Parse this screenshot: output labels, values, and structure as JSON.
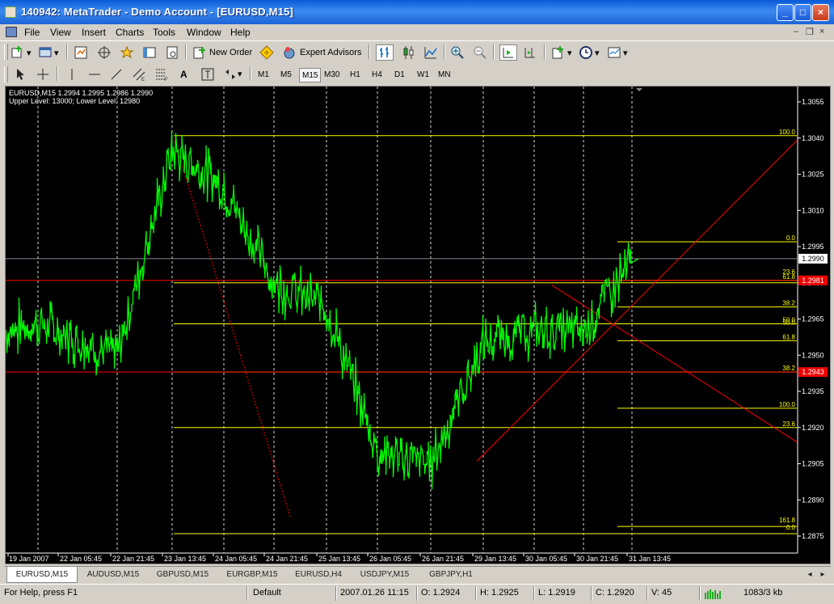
{
  "window": {
    "title": "140942: MetaTrader - Demo Account - [EURUSD,M15]"
  },
  "menu": [
    "File",
    "View",
    "Insert",
    "Charts",
    "Tools",
    "Window",
    "Help"
  ],
  "toolbar": {
    "new_order_label": "New Order",
    "expert_advisors_label": "Expert Advisors"
  },
  "timeframes": [
    "M1",
    "M5",
    "M15",
    "M30",
    "H1",
    "H4",
    "D1",
    "W1",
    "MN"
  ],
  "active_timeframe": "M15",
  "chart": {
    "header_line1": "EURUSD,M15  1.2994 1.2995 1.2986 1.2990",
    "header_line2": "Upper Level: 13000;  Lower Level: 12980",
    "price_labels": [
      "1.3055",
      "1.3040",
      "1.3025",
      "1.3010",
      "1.2995",
      "1.2980",
      "1.2965",
      "1.2950",
      "1.2935",
      "1.2920",
      "1.2905",
      "1.2890",
      "1.2875"
    ],
    "current_price": "1.2990",
    "red_level_upper": "1.2981",
    "red_level_lower": "1.2943",
    "fib_labels": [
      "100.0",
      "0.0",
      "23.6",
      "61.8",
      "38.2",
      "50.0",
      "50.0",
      "61.8",
      "38.2",
      "100.0",
      "23.6",
      "161.8",
      "0.0"
    ],
    "time_labels": [
      "19 Jan 2007",
      "22 Jan 05:45",
      "22 Jan 21:45",
      "23 Jan 13:45",
      "24 Jan 05:45",
      "24 Jan 21:45",
      "25 Jan 13:45",
      "26 Jan 05:45",
      "26 Jan 21:45",
      "29 Jan 13:45",
      "30 Jan 05:45",
      "30 Jan 21:45",
      "31 Jan 13:45"
    ],
    "colors": {
      "background": "#000000",
      "candles": "#00ff00",
      "fibo": "#ffff00",
      "levels": "#ff0000",
      "grid": "#ffffff"
    }
  },
  "chart_data": {
    "type": "line",
    "title": "EURUSD,M15",
    "xlabel": "",
    "ylabel": "",
    "ylim": [
      1.287,
      1.306
    ],
    "x": [
      "19 Jan 2007",
      "22 Jan 05:45",
      "22 Jan 21:45",
      "23 Jan 13:45",
      "24 Jan 05:45",
      "24 Jan 21:45",
      "25 Jan 13:45",
      "26 Jan 05:45",
      "26 Jan 21:45",
      "29 Jan 13:45",
      "30 Jan 05:45",
      "30 Jan 21:45",
      "31 Jan 13:45"
    ],
    "series": [
      {
        "name": "EURUSD,M15",
        "values": [
          1.296,
          1.2963,
          1.295,
          1.3035,
          1.302,
          1.298,
          1.297,
          1.291,
          1.2905,
          1.2955,
          1.296,
          1.296,
          1.299
        ]
      }
    ],
    "grid": true,
    "legend": "none"
  },
  "tabs": [
    "EURUSD,M15",
    "AUDUSD,M15",
    "GBPUSD,M15",
    "EURGBP,M15",
    "EURUSD,H4",
    "USDJPY,M15",
    "GBPJPY,H1"
  ],
  "active_tab": "EURUSD,M15",
  "status": {
    "help": "For Help, press F1",
    "profile": "Default",
    "datetime": "2007.01.26 11:15",
    "open": "O: 1.2924",
    "high": "H: 1.2925",
    "low": "L: 1.2919",
    "close": "C: 1.2920",
    "volume": "V: 45",
    "traffic": "1083/3 kb"
  }
}
